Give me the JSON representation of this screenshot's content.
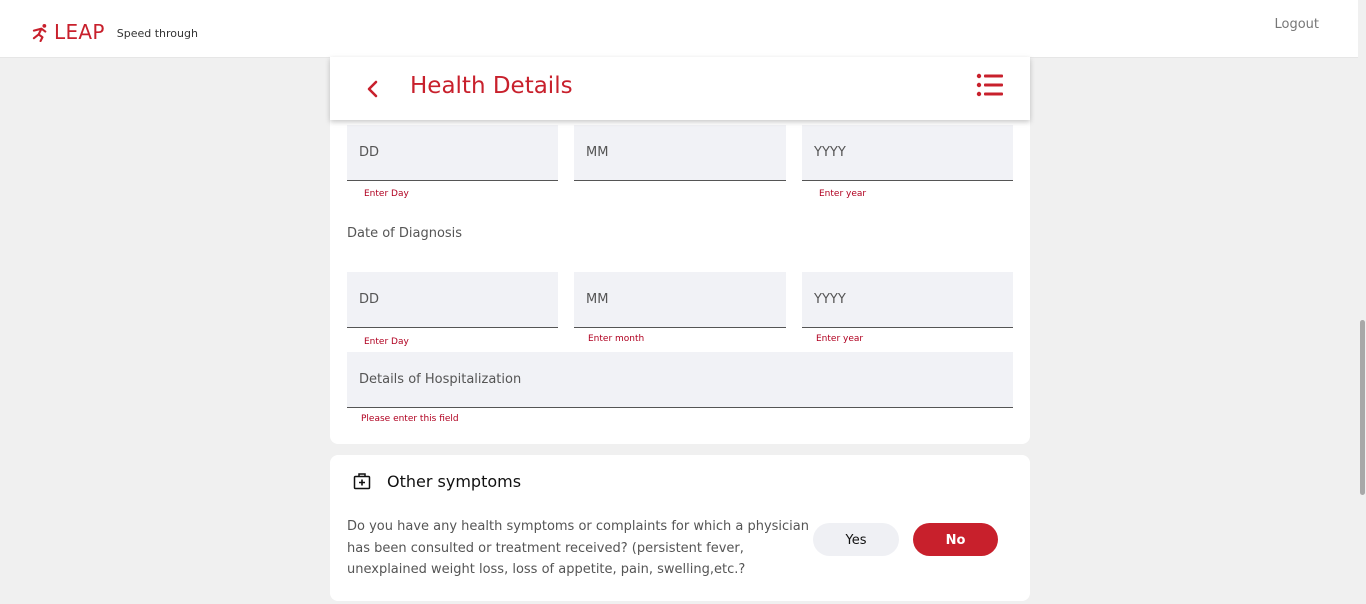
{
  "brand": {
    "name": "LEAP",
    "tagline": "Speed through"
  },
  "topbar": {
    "logout_label": "Logout"
  },
  "header": {
    "title": "Health Details"
  },
  "dob_row": {
    "day": {
      "placeholder": "DD",
      "error": "Enter Day"
    },
    "month": {
      "placeholder": "MM",
      "error": ""
    },
    "year": {
      "placeholder": "YYYY",
      "error": "Enter year"
    }
  },
  "diagnosis": {
    "label": "Date of Diagnosis",
    "day": {
      "placeholder": "DD",
      "error": "Enter Day"
    },
    "month": {
      "placeholder": "MM",
      "error": "Enter month"
    },
    "year": {
      "placeholder": "YYYY",
      "error": "Enter year"
    }
  },
  "hospitalization": {
    "placeholder": "Details of Hospitalization",
    "error": "Please enter this field"
  },
  "other_symptoms": {
    "title": "Other symptoms",
    "question": "Do you have any health symptoms or complaints for which a physician has been consulted or treatment received? (persistent fever, unexplained weight loss, loss of appetite, pain, swelling,etc.?",
    "yes_label": "Yes",
    "no_label": "No"
  },
  "colors": {
    "accent": "#c8202c",
    "field_bg": "#f1f2f6",
    "error": "#b00020",
    "page_bg": "#f0f0f0"
  },
  "icons": [
    "runner-logo-icon",
    "chevron-left-icon",
    "list-menu-icon",
    "medical-kit-icon"
  ]
}
